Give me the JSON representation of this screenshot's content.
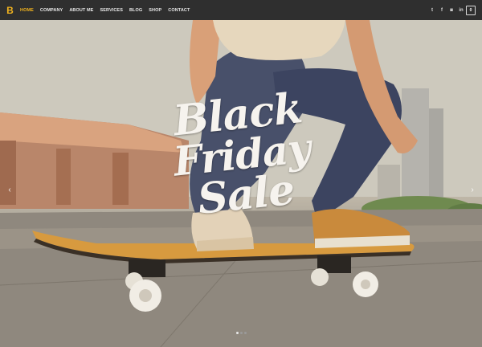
{
  "brand": {
    "logo_text": "B",
    "accent": "#f0b21f"
  },
  "nav": {
    "items": [
      {
        "label": "HOME",
        "active": true
      },
      {
        "label": "COMPANY",
        "active": false
      },
      {
        "label": "ABOUT ME",
        "active": false
      },
      {
        "label": "SERVICES",
        "active": false
      },
      {
        "label": "BLOG",
        "active": false
      },
      {
        "label": "SHOP",
        "active": false
      },
      {
        "label": "CONTACT",
        "active": false
      }
    ]
  },
  "social": {
    "twitter": "t",
    "facebook": "f",
    "instagram": "◙",
    "linkedin": "in"
  },
  "cart": {
    "count": "0"
  },
  "hero": {
    "headline_line1": "Black",
    "headline_line2": "Friday",
    "headline_line3": "Sale",
    "prev_symbol": "‹",
    "next_symbol": "›"
  },
  "slider": {
    "dot_count": 3,
    "active_index": 0
  }
}
